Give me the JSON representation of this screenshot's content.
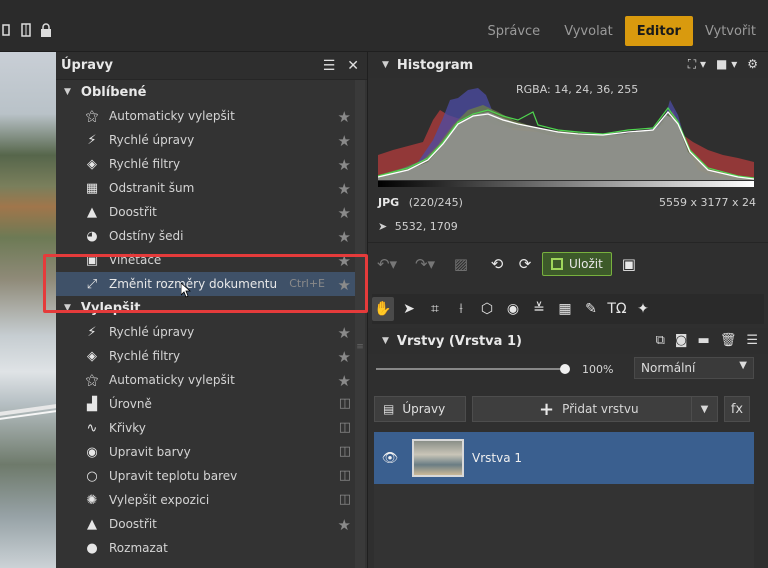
{
  "topbar": {
    "modes": [
      "Správce",
      "Vyvolat",
      "Editor",
      "Vytvořit"
    ],
    "active_mode": "Editor"
  },
  "adjustments": {
    "title": "Úpravy",
    "sections": [
      {
        "title": "Oblíbené",
        "items": [
          {
            "label": "Automaticky vylepšit",
            "icon": "magic-wand-icon",
            "right": "star"
          },
          {
            "label": "Rychlé úpravy",
            "icon": "lightning-icon",
            "right": "star"
          },
          {
            "label": "Rychlé filtry",
            "icon": "filters-icon",
            "right": "star"
          },
          {
            "label": "Odstranit šum",
            "icon": "noise-icon",
            "right": "star"
          },
          {
            "label": "Doostřit",
            "icon": "sharpen-icon",
            "right": "star"
          },
          {
            "label": "Odstíny šedi",
            "icon": "grayscale-icon",
            "right": "star"
          },
          {
            "label": "Vinětace",
            "icon": "vignette-icon",
            "right": "star"
          },
          {
            "label": "Změnit rozměry dokumentu",
            "icon": "resize-icon",
            "right": "star",
            "shortcut": "Ctrl+E",
            "selected": true
          }
        ]
      },
      {
        "title": "Vylepšit",
        "items": [
          {
            "label": "Rychlé úpravy",
            "icon": "lightning-icon",
            "right": "star"
          },
          {
            "label": "Rychlé filtry",
            "icon": "filters-icon",
            "right": "star"
          },
          {
            "label": "Automaticky vylepšit",
            "icon": "magic-wand-icon",
            "right": "star"
          },
          {
            "label": "Úrovně",
            "icon": "levels-icon",
            "right": "layer"
          },
          {
            "label": "Křivky",
            "icon": "curves-icon",
            "right": "layer"
          },
          {
            "label": "Upravit barvy",
            "icon": "palette-icon",
            "right": "layer"
          },
          {
            "label": "Upravit teplotu barev",
            "icon": "bulb-icon",
            "right": "layer"
          },
          {
            "label": "Vylepšit expozici",
            "icon": "exposure-icon",
            "right": "layer"
          },
          {
            "label": "Doostřit",
            "icon": "sharpen-icon",
            "right": "star"
          },
          {
            "label": "Rozmazat",
            "icon": "blur-icon",
            "right": "none"
          }
        ]
      }
    ]
  },
  "histogram": {
    "title": "Histogram",
    "rgba": "RGBA:  14,  24,  36, 255",
    "format": "JPG",
    "format_detail": "(220/245)",
    "dimensions": "5559 x 3177 x 24",
    "cursor_pos": "5532, 1709"
  },
  "actions": {
    "save_label": "Uložit"
  },
  "layers": {
    "title": "Vrstvy (Vrstva 1)",
    "opacity": "100%",
    "blend_mode": "Normální",
    "adjust_label": "Úpravy",
    "add_layer_label": "Přidat vrstvu",
    "fx_label": "fx",
    "items": [
      {
        "name": "Vrstva 1",
        "selected": true
      }
    ]
  },
  "colors": {
    "accent": "#d99a0e",
    "selection": "#3f5168",
    "layer_selected": "#3a5f8f",
    "highlight_box": "#e53b3b",
    "save_border": "#78b13e"
  }
}
